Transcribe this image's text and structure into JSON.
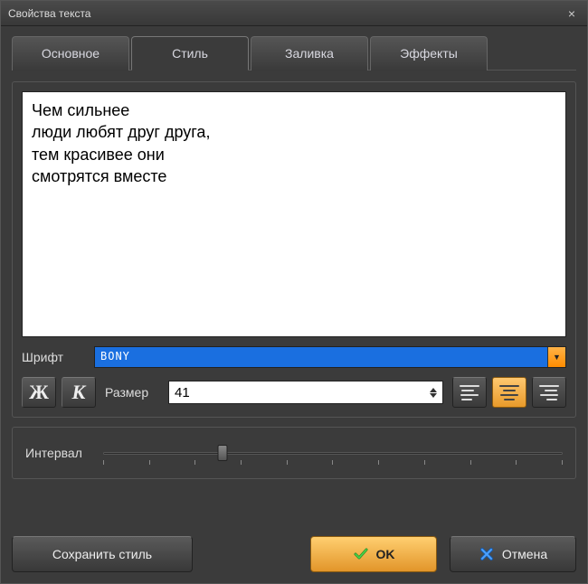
{
  "window": {
    "title": "Свойства текста"
  },
  "tabs": [
    {
      "label": "Основное",
      "active": false
    },
    {
      "label": "Стиль",
      "active": true
    },
    {
      "label": "Заливка",
      "active": false
    },
    {
      "label": "Эффекты",
      "active": false
    }
  ],
  "preview": {
    "text": "Чем сильнее\nлюди любят друг друга,\nтем красивее они\nсмотрятся вместе"
  },
  "font": {
    "label": "Шрифт",
    "value": "BONY"
  },
  "size": {
    "label": "Размер",
    "value": "41"
  },
  "styleButtons": {
    "bold": "Ж",
    "italic": "К"
  },
  "alignment": "center",
  "interval": {
    "label": "Интервал",
    "position_percent": 26
  },
  "buttons": {
    "save_style": "Сохранить стиль",
    "ok": "OK",
    "cancel": "Отмена"
  },
  "icons": {
    "close": "×",
    "check": "check-icon",
    "cross": "cross-icon"
  }
}
